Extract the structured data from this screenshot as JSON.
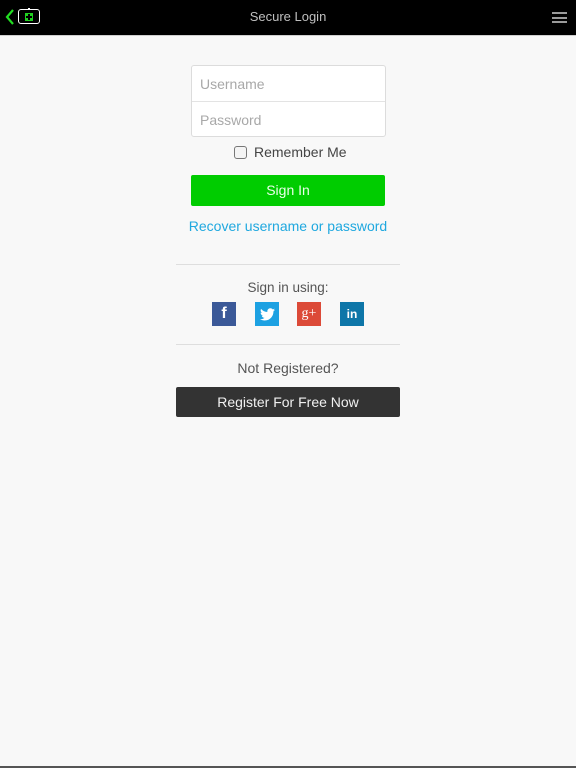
{
  "header": {
    "title": "Secure Login",
    "back_icon": "chevron-left-icon",
    "app_icon": "add-screen-icon",
    "menu_icon": "hamburger-menu-icon"
  },
  "login": {
    "username_placeholder": "Username",
    "username_value": "",
    "password_placeholder": "Password",
    "password_value": "",
    "remember_label": "Remember Me",
    "remember_checked": false,
    "signin_label": "Sign In",
    "recover_link": "Recover username or password"
  },
  "social": {
    "heading": "Sign in using:",
    "providers": [
      {
        "name": "facebook",
        "glyph": "f"
      },
      {
        "name": "twitter",
        "glyph": "🐦"
      },
      {
        "name": "google-plus",
        "glyph": "g+"
      },
      {
        "name": "linkedin",
        "glyph": "in"
      }
    ]
  },
  "register": {
    "prompt": "Not Registered?",
    "button_label": "Register For Free Now"
  },
  "colors": {
    "signin_green": "#00cc00",
    "link_blue": "#1fa8df",
    "register_dark": "#333333"
  }
}
